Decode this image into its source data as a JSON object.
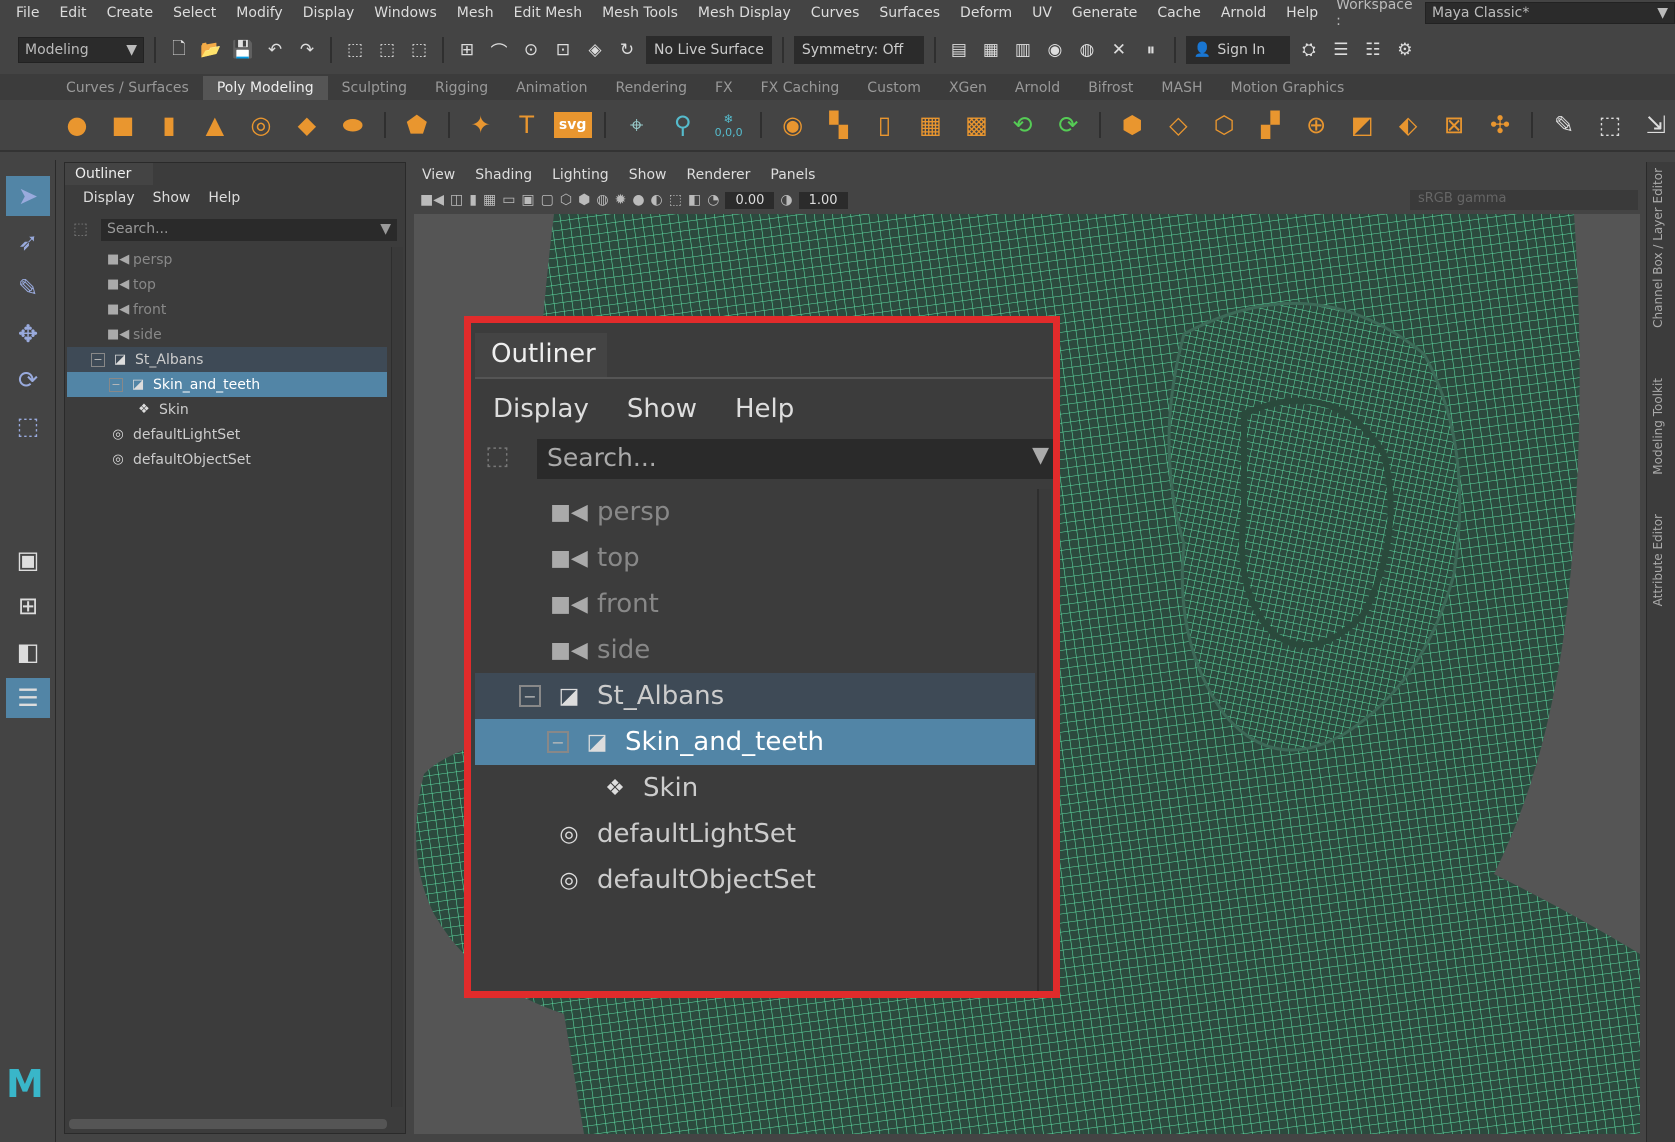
{
  "menubar": {
    "items": [
      "File",
      "Edit",
      "Create",
      "Select",
      "Modify",
      "Display",
      "Windows",
      "Mesh",
      "Edit Mesh",
      "Mesh Tools",
      "Mesh Display",
      "Curves",
      "Surfaces",
      "Deform",
      "UV",
      "Generate",
      "Cache",
      "Arnold",
      "Help"
    ],
    "workspace_label": "Workspace :",
    "workspace_value": "Maya Classic*"
  },
  "statusline": {
    "mode": "Modeling",
    "live_surface": "No Live Surface",
    "symmetry": "Symmetry: Off",
    "sign_in": "Sign In"
  },
  "shelf": {
    "tabs": [
      "Curves / Surfaces",
      "Poly Modeling",
      "Sculpting",
      "Rigging",
      "Animation",
      "Rendering",
      "FX",
      "FX Caching",
      "Custom",
      "XGen",
      "Arnold",
      "Bifrost",
      "MASH",
      "Motion Graphics"
    ],
    "active_tab": "Poly Modeling",
    "svg_label": "svg",
    "text_label": "T",
    "coords_label": "0,0,0"
  },
  "outliner": {
    "tab": "Outliner",
    "menu": [
      "Display",
      "Show",
      "Help"
    ],
    "search_placeholder": "Search...",
    "items": [
      {
        "label": "persp",
        "icon": "camera-icon",
        "state": "dim"
      },
      {
        "label": "top",
        "icon": "camera-icon",
        "state": "dim"
      },
      {
        "label": "front",
        "icon": "camera-icon",
        "state": "dim"
      },
      {
        "label": "side",
        "icon": "camera-icon",
        "state": "dim"
      },
      {
        "label": "St_Albans",
        "icon": "group-icon",
        "state": "parent"
      },
      {
        "label": "Skin_and_teeth",
        "icon": "group-icon",
        "state": "selected"
      },
      {
        "label": "Skin",
        "icon": "mesh-icon",
        "state": "normal"
      },
      {
        "label": "defaultLightSet",
        "icon": "set-icon",
        "state": "normal"
      },
      {
        "label": "defaultObjectSet",
        "icon": "set-icon",
        "state": "normal"
      }
    ]
  },
  "viewport": {
    "menu": [
      "View",
      "Shading",
      "Lighting",
      "Show",
      "Renderer",
      "Panels"
    ],
    "exposure": "0.00",
    "gamma_value": "1.00",
    "color_space": "sRGB gamma",
    "wire_color": "#5fe0a6"
  },
  "rightrail": {
    "tabs": [
      "Channel Box / Layer Editor",
      "Modeling Toolkit",
      "Attribute Editor"
    ]
  },
  "colors": {
    "highlight_border": "#e12b2b",
    "selection": "#5285a6",
    "accent": "#e9962f"
  }
}
